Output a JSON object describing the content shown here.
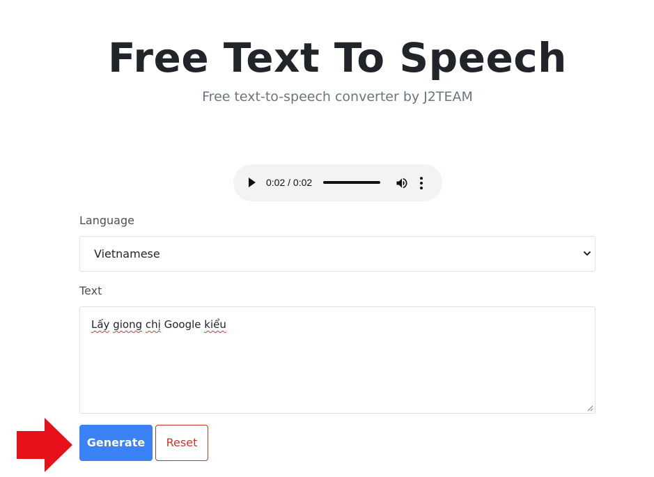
{
  "header": {
    "title": "Free Text To Speech",
    "subtitle": "Free text-to-speech converter by J2TEAM"
  },
  "audio_player": {
    "time": "0:02 / 0:02",
    "progress": 1.0,
    "icons": [
      "play-icon",
      "volume-icon",
      "more-options-icon"
    ]
  },
  "form": {
    "language_label": "Language",
    "language_value": "Vietnamese",
    "text_label": "Text",
    "text_parts": [
      "Lấy",
      " ",
      "giong",
      " ",
      "chị",
      " Google ",
      "kiểu"
    ]
  },
  "actions": {
    "generate_label": "Generate",
    "reset_label": "Reset"
  },
  "colors": {
    "primary": "#3b82f6",
    "danger": "#c0392b",
    "annotation_arrow": "#e8111b"
  }
}
